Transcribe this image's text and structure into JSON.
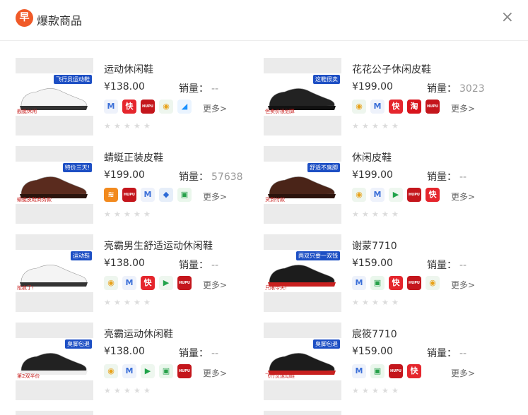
{
  "header": {
    "logo_char": "早",
    "title": "爆款商品",
    "close_glyph": "×"
  },
  "products": [
    {
      "name": "运动休闲鞋",
      "price": "¥138.00",
      "sales_label": "销量：",
      "sales": "--",
      "banner": "飞行员运动鞋",
      "banner2": "舰艇休闲",
      "icons": [
        "app-icon-a",
        "app-icon-b",
        "hupu-icon",
        "app-icon-c",
        "app-icon-d"
      ],
      "more": "更多>",
      "shoe_color": "#f4f4f4",
      "sole_color": "#333"
    },
    {
      "name": "花花公子休闲皮鞋",
      "price": "¥199.00",
      "sales_label": "销量：",
      "sales": "3023",
      "banner": "这鞋很卖",
      "banner2": "但卖价很划算",
      "icons": [
        "app-icon-c",
        "app-icon-a",
        "app-icon-b",
        "app-icon-e",
        "hupu-icon"
      ],
      "more": "更多>",
      "shoe_color": "#222",
      "sole_color": "#111"
    },
    {
      "name": "蜻蜓正装皮鞋",
      "price": "¥199.00",
      "sales_label": "销量：",
      "sales": "57638",
      "banner": "特价三天!",
      "banner2": "蜻蜓皮鞋商务款",
      "icons": [
        "app-icon-f",
        "hupu-icon",
        "app-icon-a",
        "app-icon-g",
        "app-icon-h"
      ],
      "more": "更多>",
      "shoe_color": "#5a2b1e",
      "sole_color": "#2a140d"
    },
    {
      "name": "休闲皮鞋",
      "price": "¥199.00",
      "sales_label": "销量：",
      "sales": "--",
      "banner": "舒适不臭脚",
      "banner2": "货到付款",
      "icons": [
        "app-icon-c",
        "app-icon-a",
        "app-icon-i",
        "hupu-icon",
        "app-icon-b"
      ],
      "more": "更多>",
      "shoe_color": "#4a2418",
      "sole_color": "#2b130c"
    },
    {
      "name": "亮霸男生舒适运动休闲鞋",
      "price": "¥138.00",
      "sales_label": "销量：",
      "sales": "--",
      "banner": "运动鞋",
      "banner2": "抢疯了!",
      "icons": [
        "app-icon-c",
        "app-icon-a",
        "app-icon-b",
        "app-icon-i",
        "hupu-icon"
      ],
      "more": "更多>",
      "shoe_color": "#f4f4f4",
      "sole_color": "#333"
    },
    {
      "name": "谢蒙7710",
      "price": "¥159.00",
      "sales_label": "销量：",
      "sales": "--",
      "banner": "两双只要一双钱",
      "banner2": "只限今天!",
      "icons": [
        "app-icon-a",
        "app-icon-h",
        "app-icon-b",
        "hupu-icon",
        "app-icon-c"
      ],
      "more": "更多>",
      "shoe_color": "#1c1c1c",
      "sole_color": "#c8201f"
    },
    {
      "name": "亮霸运动休闲鞋",
      "price": "¥138.00",
      "sales_label": "销量：",
      "sales": "--",
      "banner": "臭脚包退",
      "banner2": "第2双半价",
      "icons": [
        "app-icon-c",
        "app-icon-a",
        "app-icon-i",
        "app-icon-h",
        "hupu-icon"
      ],
      "more": "更多>",
      "shoe_color": "#222",
      "sole_color": "#eee"
    },
    {
      "name": "宸筱7710",
      "price": "¥159.00",
      "sales_label": "销量：",
      "sales": "--",
      "banner": "臭脚包退",
      "banner2": "飞行员运动鞋",
      "icons": [
        "app-icon-a",
        "app-icon-h",
        "hupu-icon",
        "app-icon-b"
      ],
      "more": "更多>",
      "shoe_color": "#1c1c1c",
      "sole_color": "#c8201f"
    }
  ],
  "icon_styles": {
    "app-icon-a": {
      "bg": "#eef2fb",
      "fg": "#3b6fd8",
      "glyph": "M"
    },
    "app-icon-b": {
      "bg": "#e5262d",
      "fg": "#fff",
      "glyph": "快"
    },
    "hupu-icon": {
      "bg": "#c4161c",
      "fg": "#fff",
      "glyph": "HUPU"
    },
    "app-icon-c": {
      "bg": "#eef6ee",
      "fg": "#e8a21a",
      "glyph": "◉"
    },
    "app-icon-d": {
      "bg": "#eaf4ff",
      "fg": "#1890ff",
      "glyph": "◢"
    },
    "app-icon-e": {
      "bg": "#d8141c",
      "fg": "#fff",
      "glyph": "淘"
    },
    "app-icon-f": {
      "bg": "#f28a1e",
      "fg": "#fff",
      "glyph": "≋"
    },
    "app-icon-g": {
      "bg": "#e6eef9",
      "fg": "#2d6bd6",
      "glyph": "◆"
    },
    "app-icon-h": {
      "bg": "#eaf7ec",
      "fg": "#27a14a",
      "glyph": "▣"
    },
    "app-icon-i": {
      "bg": "#eef7ef",
      "fg": "#20a34a",
      "glyph": "▶"
    }
  },
  "rating": {
    "stars": 5,
    "glyph": "★"
  }
}
